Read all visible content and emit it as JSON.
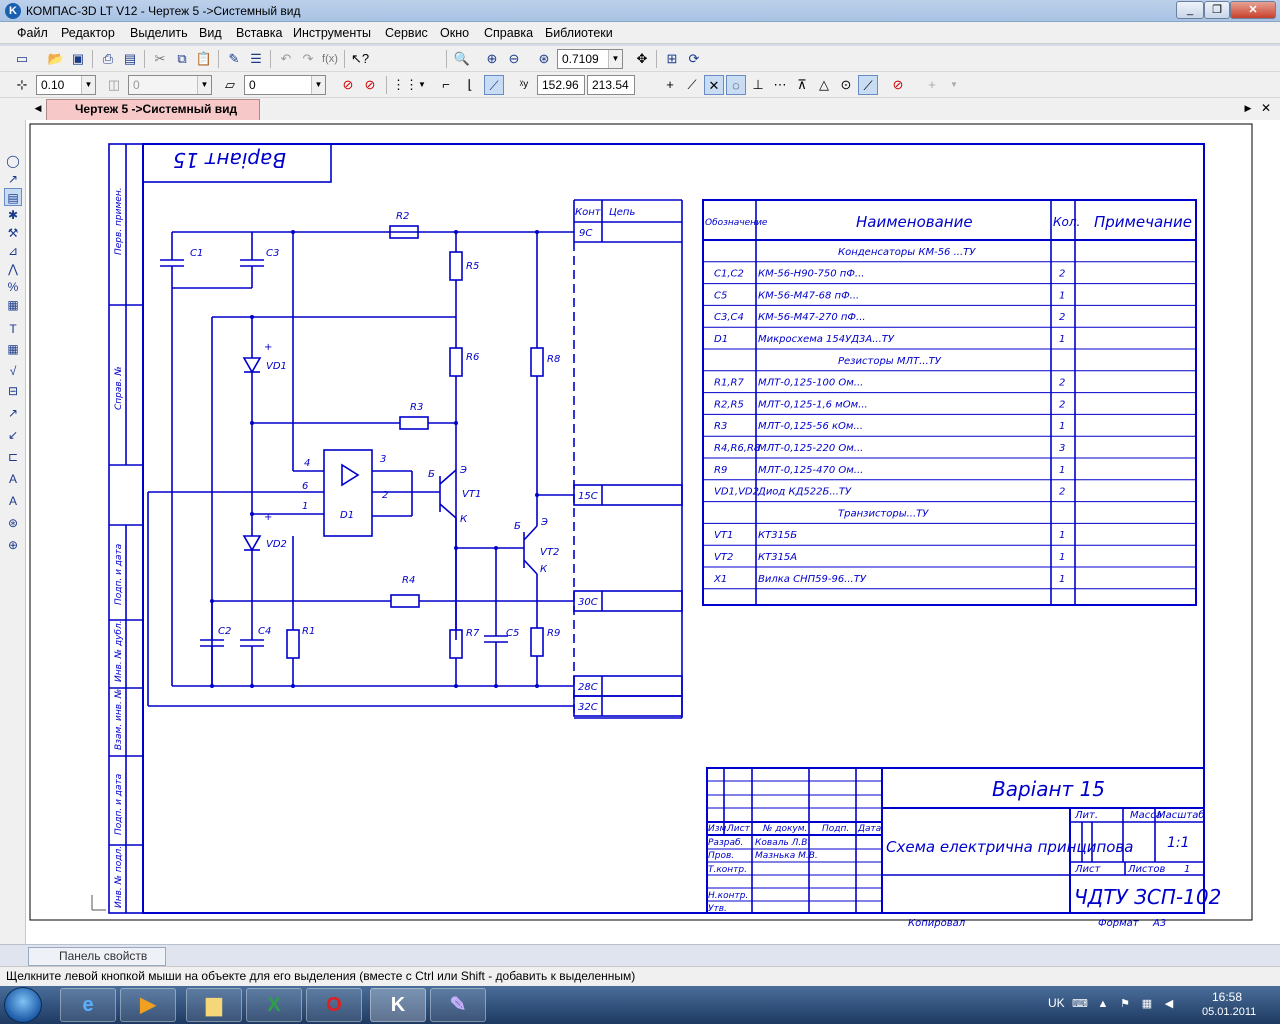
{
  "window": {
    "title": "КОМПАС-3D LT V12 - Чертеж 5 ->Системный вид",
    "app_icon": "K",
    "buttons": [
      "_",
      "❐",
      "✕"
    ]
  },
  "menu": [
    "Файл",
    "Редактор",
    "Выделить",
    "Вид",
    "Вставка",
    "Инструменты",
    "Сервис",
    "Окно",
    "Справка",
    "Библиотеки"
  ],
  "toolbar_standard": {
    "zoom_value": "0.7109"
  },
  "toolbar_current_state": {
    "step_value": "0.10",
    "layer_value": "0",
    "view_value": "0",
    "coord_x": "152.96",
    "coord_y": "213.54"
  },
  "document_tab": {
    "label": "Чертеж 5 ->Системный вид"
  },
  "drawing": {
    "variant_upside": "Варіант 15",
    "side_columns": [
      "Перв. примен.",
      "Справ. №",
      "Подп. и дата",
      "Инв. № дубл.",
      "Взам. инв. №",
      "Подп. и дата",
      "Инв. № подл."
    ],
    "components": {
      "C1": "C1",
      "C2": "C2",
      "C3": "C3",
      "C4": "C4",
      "C5": "C5",
      "R1": "R1",
      "R2": "R2",
      "R3": "R3",
      "R4": "R4",
      "R5": "R5",
      "R6": "R6",
      "R7": "R7",
      "R8": "R8",
      "R9": "R9",
      "VD1": "VD1",
      "VD2": "VD2",
      "VT1": "VT1",
      "VT2": "VT2",
      "D1": "D1",
      "plus": "+",
      "pin4": "4",
      "pin6": "6",
      "pin1": "1",
      "pin3": "3",
      "pin2": "2",
      "base": "Б",
      "emitter": "Э",
      "collector": "К"
    },
    "connector": {
      "header_cont": "Конт.",
      "header_chain": "Цепь",
      "contacts": [
        "9С",
        "15С",
        "30С",
        "28С",
        "32С"
      ]
    },
    "bom": {
      "headers": [
        "Обозначение",
        "Наименование",
        "Кол.",
        "Примечание"
      ],
      "rows": [
        {
          "type": "group",
          "name": "Конденсаторы КМ-56 ...ТУ"
        },
        {
          "ref": "C1,C2",
          "name": "КМ-56-Н90-750 пФ...",
          "qty": "2"
        },
        {
          "ref": "C5",
          "name": "КМ-56-М47-68 пФ...",
          "qty": "1"
        },
        {
          "ref": "C3,C4",
          "name": "КМ-56-М47-270 пФ...",
          "qty": "2"
        },
        {
          "ref": "D1",
          "name": "Микросхема 154УД3А...ТУ",
          "qty": "1"
        },
        {
          "type": "group",
          "name": "Резисторы МЛТ...ТУ"
        },
        {
          "ref": "R1,R7",
          "name": "МЛТ-0,125-100 Ом...",
          "qty": "2"
        },
        {
          "ref": "R2,R5",
          "name": "МЛТ-0,125-1,6 мОм...",
          "qty": "2"
        },
        {
          "ref": "R3",
          "name": "МЛТ-0,125-56 кОм...",
          "qty": "1"
        },
        {
          "ref": "R4,R6,R8",
          "name": "МЛТ-0,125-220 Ом...",
          "qty": "3"
        },
        {
          "ref": "R9",
          "name": "МЛТ-0,125-470 Ом...",
          "qty": "1"
        },
        {
          "ref": "VD1,VD2",
          "name": "Диод КД522Б...ТУ",
          "qty": "2"
        },
        {
          "type": "group",
          "name": "Транзисторы...ТУ"
        },
        {
          "ref": "VT1",
          "name": "КТ315Б",
          "qty": "1"
        },
        {
          "ref": "VT2",
          "name": "КТ315А",
          "qty": "1"
        },
        {
          "ref": "X1",
          "name": "Вилка СНП59-96...ТУ",
          "qty": "1"
        }
      ]
    },
    "title_block": {
      "variant": "Варіант 15",
      "doc_title": "Схема електрична принципова",
      "code": "ЧДТУ ЗСП-102",
      "scale": "1:1",
      "lit": "Лит.",
      "mass": "Масса",
      "masshtab": "Масштаб",
      "list": "Лист",
      "listov": "Листов",
      "listov_val": "1",
      "izm": "Изм.",
      "list_col": "Лист",
      "doc_no": "№ докум.",
      "podp": "Подп.",
      "date": "Дата",
      "razrab": "Разраб.",
      "razrab_name": "Коваль Л.В.",
      "prov": "Пров.",
      "prov_name": "Мазнька М.В.",
      "tkontr": "Т.контр.",
      "nkontr": "Н.контр.",
      "utv": "Утв.",
      "copied": "Копировал",
      "format": "Формат",
      "format_val": "А3"
    }
  },
  "props_panel": {
    "label": "Панель свойств"
  },
  "status": "Щелкните левой кнопкой мыши на объекте для его выделения (вместе с Ctrl или Shift - добавить к выделенным)",
  "taskbar": {
    "language": "UK",
    "time": "16:58",
    "date": "05.01.2011",
    "apps": [
      "IE",
      "Media",
      "Explorer",
      "Excel",
      "Opera",
      "Kompas",
      "Pencil"
    ]
  },
  "colors": {
    "drawing_line": "#0000cc",
    "tab_active": "#f6c8c8",
    "canvas": "#ffffff"
  }
}
